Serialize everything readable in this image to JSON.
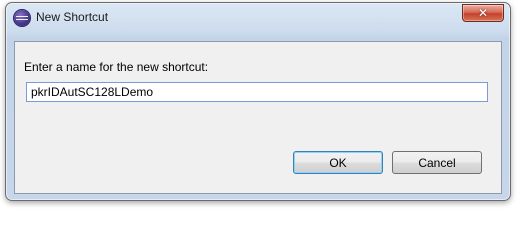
{
  "window": {
    "title": "New Shortcut",
    "app_icon": "eclipse-icon",
    "close_icon": "close-icon",
    "close_glyph": "✕"
  },
  "dialog": {
    "prompt": "Enter a name for the new shortcut:",
    "name_value": "pkrIDAutSC128LDemo"
  },
  "buttons": {
    "ok_label": "OK",
    "cancel_label": "Cancel"
  },
  "colors": {
    "frame": "#c7d6ea",
    "close_button": "#c4412a",
    "client_background": "#f0f0f0",
    "default_button_border": "#3c7fb1"
  }
}
